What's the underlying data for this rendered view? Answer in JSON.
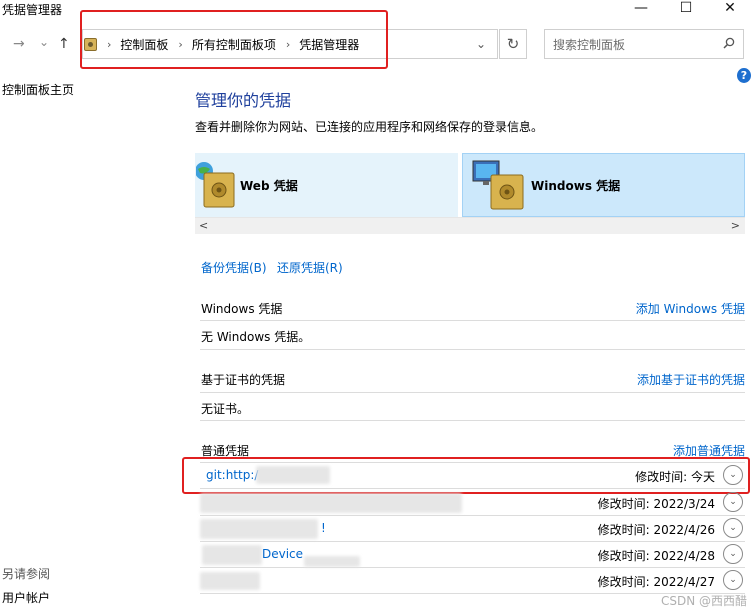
{
  "window": {
    "title": "凭据管理器",
    "minimize": "—",
    "maximize": "☐",
    "close": "✕"
  },
  "nav": {
    "back": "→",
    "recent": "⌄",
    "up": "↑"
  },
  "address": {
    "crumbs": [
      "控制面板",
      "所有控制面板项",
      "凭据管理器"
    ],
    "separator": "›",
    "dropdown": "⌄",
    "refresh": "↻"
  },
  "search": {
    "placeholder": "搜索控制面板"
  },
  "help_label": "?",
  "sidebar": {
    "home": "控制面板主页",
    "see_also": "另请参阅",
    "user_accounts": "用户帐户"
  },
  "main": {
    "title": "管理你的凭据",
    "description": "查看并删除你为网站、已连接的应用程序和网络保存的登录信息。",
    "tiles": {
      "web": "Web 凭据",
      "windows": "Windows 凭据"
    },
    "scroll": {
      "left": "<",
      "right": ">"
    },
    "backup": "备份凭据(B)",
    "restore": "还原凭据(R)",
    "sections": {
      "windows": {
        "title": "Windows 凭据",
        "add": "添加 Windows 凭据",
        "empty": "无 Windows 凭据。"
      },
      "cert": {
        "title": "基于证书的凭据",
        "add": "添加基于证书的凭据",
        "empty": "无证书。"
      },
      "generic": {
        "title": "普通凭据",
        "add": "添加普通凭据"
      }
    },
    "generic_rows": [
      {
        "name": "git:http:/",
        "modified": "修改时间:  今天"
      },
      {
        "name": "",
        "modified": "修改时间:  2022/3/24"
      },
      {
        "name": "!",
        "modified": "修改时间:  2022/4/26"
      },
      {
        "name": "Device",
        "modified": "修改时间:  2022/4/28"
      },
      {
        "name": "",
        "modified": "修改时间:  2022/4/27"
      }
    ],
    "chevron": "⌄"
  },
  "watermark": "CSDN @西西醋",
  "colors": {
    "link": "#0066cc",
    "title": "#1e3f9c",
    "annotation_red": "#e02020",
    "selected_tile": "#cce8fb"
  }
}
